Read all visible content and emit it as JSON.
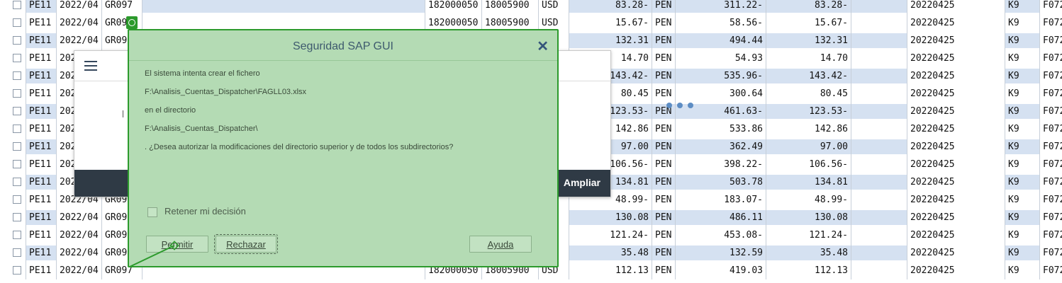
{
  "grid": {
    "rows": [
      {
        "c1": "PE11",
        "c2": "2022/04",
        "c3": "GR097",
        "c4": "182000050",
        "c5": "18005900",
        "c6": "USD",
        "c7": "83.28-",
        "c8": "PEN",
        "c9": "311.22-",
        "c10": "83.28-",
        "c11": "20220425",
        "c12": "K9",
        "c13": "F072"
      },
      {
        "c1": "PE11",
        "c2": "2022/04",
        "c3": "GR09",
        "c4": "182000050",
        "c5": "18005900",
        "c6": "USD",
        "c7": "15.67-",
        "c8": "PEN",
        "c9": "58.56-",
        "c10": "15.67-",
        "c11": "20220425",
        "c12": "K9",
        "c13": "F072"
      },
      {
        "c1": "PE11",
        "c2": "2022/04",
        "c3": "GR09",
        "c4": "",
        "c5": "",
        "c6": "",
        "c7": "132.31",
        "c8": "PEN",
        "c9": "494.44",
        "c10": "132.31",
        "c11": "20220425",
        "c12": "K9",
        "c13": "F072"
      },
      {
        "c1": "PE11",
        "c2": "202",
        "c3": "",
        "c4": "",
        "c5": "",
        "c6": "",
        "c7": "14.70",
        "c8": "PEN",
        "c9": "54.93",
        "c10": "14.70",
        "c11": "20220425",
        "c12": "K9",
        "c13": "F072"
      },
      {
        "c1": "PE11",
        "c2": "202",
        "c3": "",
        "c4": "",
        "c5": "",
        "c6": "",
        "c7": "143.42-",
        "c8": "PEN",
        "c9": "535.96-",
        "c10": "143.42-",
        "c11": "20220425",
        "c12": "K9",
        "c13": "F072"
      },
      {
        "c1": "PE11",
        "c2": "202",
        "c3": "",
        "c4": "",
        "c5": "",
        "c6": "",
        "c7": "80.45",
        "c8": "PEN",
        "c9": "300.64",
        "c10": "80.45",
        "c11": "20220425",
        "c12": "K9",
        "c13": "F072"
      },
      {
        "c1": "PE11",
        "c2": "202",
        "c3": "",
        "c4": "",
        "c5": "",
        "c6": "",
        "c7": "123.53-",
        "c8": "PEN",
        "c9": "461.63-",
        "c10": "123.53-",
        "c11": "20220425",
        "c12": "K9",
        "c13": "F072"
      },
      {
        "c1": "PE11",
        "c2": "202",
        "c3": "",
        "c4": "",
        "c5": "",
        "c6": "",
        "c7": "142.86",
        "c8": "PEN",
        "c9": "533.86",
        "c10": "142.86",
        "c11": "20220425",
        "c12": "K9",
        "c13": "F072"
      },
      {
        "c1": "PE11",
        "c2": "202",
        "c3": "",
        "c4": "",
        "c5": "",
        "c6": "",
        "c7": "97.00",
        "c8": "PEN",
        "c9": "362.49",
        "c10": "97.00",
        "c11": "20220425",
        "c12": "K9",
        "c13": "F072"
      },
      {
        "c1": "PE11",
        "c2": "202",
        "c3": "",
        "c4": "",
        "c5": "",
        "c6": "",
        "c7": "106.56-",
        "c8": "PEN",
        "c9": "398.22-",
        "c10": "106.56-",
        "c11": "20220425",
        "c12": "K9",
        "c13": "F072"
      },
      {
        "c1": "PE11",
        "c2": "202",
        "c3": "",
        "c4": "",
        "c5": "",
        "c6": "",
        "c7": "134.81",
        "c8": "PEN",
        "c9": "503.78",
        "c10": "134.81",
        "c11": "20220425",
        "c12": "K9",
        "c13": "F072"
      },
      {
        "c1": "PE11",
        "c2": "2022/04",
        "c3": "GR09",
        "c4": "",
        "c5": "",
        "c6": "",
        "c7": "48.99-",
        "c8": "PEN",
        "c9": "183.07-",
        "c10": "48.99-",
        "c11": "20220425",
        "c12": "K9",
        "c13": "F072"
      },
      {
        "c1": "PE11",
        "c2": "2022/04",
        "c3": "GR09",
        "c4": "",
        "c5": "",
        "c6": "",
        "c7": "130.08",
        "c8": "PEN",
        "c9": "486.11",
        "c10": "130.08",
        "c11": "20220425",
        "c12": "K9",
        "c13": "F072"
      },
      {
        "c1": "PE11",
        "c2": "2022/04",
        "c3": "GR09",
        "c4": "",
        "c5": "",
        "c6": "",
        "c7": "121.24-",
        "c8": "PEN",
        "c9": "453.08-",
        "c10": "121.24-",
        "c11": "20220425",
        "c12": "K9",
        "c13": "F072"
      },
      {
        "c1": "PE11",
        "c2": "2022/04",
        "c3": "GR09",
        "c4": "",
        "c5": "",
        "c6": "",
        "c7": "35.48",
        "c8": "PEN",
        "c9": "132.59",
        "c10": "35.48",
        "c11": "20220425",
        "c12": "K9",
        "c13": "F072"
      },
      {
        "c1": "PE11",
        "c2": "2022/04",
        "c3": "GR097",
        "c4": "182000050",
        "c5": "18005900",
        "c6": "USD",
        "c7": "112.13",
        "c8": "PEN",
        "c9": "419.03",
        "c10": "112.13",
        "c11": "20220425",
        "c12": "K9",
        "c13": "F072"
      }
    ]
  },
  "back_dialog": {
    "footer_button": "Ampliar"
  },
  "security_dialog": {
    "title": "Seguridad SAP GUI",
    "close_glyph": "✕",
    "line1": "El sistema intenta crear el fichero",
    "line2": "F:\\Analisis_Cuentas_Dispatcher\\FAGLL03.xlsx",
    "line3": "en el directorio",
    "line4": "F:\\Analisis_Cuentas_Dispatcher\\",
    "line5": ". ¿Desea autorizar la modificaciones del directorio superior y de todos los subdirectorios?",
    "retain_label": "Retener mi decisión",
    "buttons": {
      "allow": "Permitir",
      "deny": "Rechazar",
      "help": "Ayuda"
    }
  },
  "colors": {
    "dialog_bg": "#b4dbb4",
    "dialog_border": "#2c9a2c",
    "row_shade": "#d5e1f1",
    "footer_dark": "#2f3a45"
  }
}
